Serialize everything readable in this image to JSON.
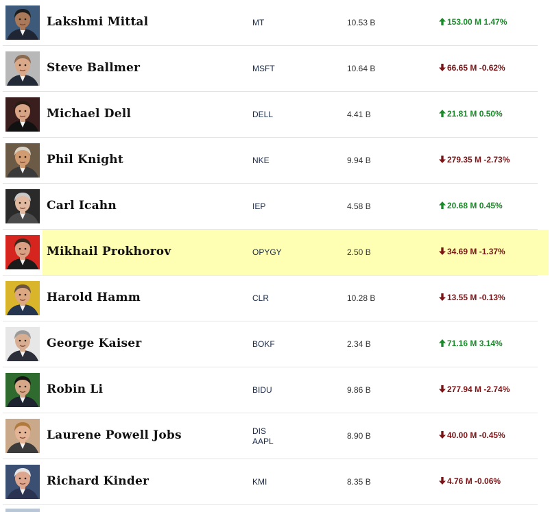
{
  "rows": [
    {
      "name": "Lakshmi Mittal",
      "ticker": [
        "MT"
      ],
      "worth": "10.53 B",
      "change": "153.00 M 1.47%",
      "direction": "up",
      "skin": "#a9795a",
      "hair": "#1c1c1c",
      "bg": "#3d5a7a",
      "suit": "#1f2533"
    },
    {
      "name": "Steve Ballmer",
      "ticker": [
        "MSFT"
      ],
      "worth": "10.64 B",
      "change": "66.65 M -0.62%",
      "direction": "down",
      "skin": "#d9a98a",
      "hair": "#8a6a50",
      "bg": "#b8b8b8",
      "suit": "#222a38"
    },
    {
      "name": "Michael Dell",
      "ticker": [
        "DELL"
      ],
      "worth": "4.41 B",
      "change": "21.81 M 0.50%",
      "direction": "up",
      "skin": "#d7a486",
      "hair": "#2a1c14",
      "bg": "#3a1d1d",
      "suit": "#111111"
    },
    {
      "name": "Phil Knight",
      "ticker": [
        "NKE"
      ],
      "worth": "9.94 B",
      "change": "279.35 M -2.73%",
      "direction": "down",
      "skin": "#d19c72",
      "hair": "#d8d2c4",
      "bg": "#6b5a45",
      "suit": "#3a3a3a"
    },
    {
      "name": "Carl Icahn",
      "ticker": [
        "IEP"
      ],
      "worth": "4.58 B",
      "change": "20.68 M 0.45%",
      "direction": "up",
      "skin": "#e0b9a0",
      "hair": "#c8c8c8",
      "bg": "#2a2a2a",
      "suit": "#4a4a4a"
    },
    {
      "name": "Mikhail Prokhorov",
      "ticker": [
        "OPYGY"
      ],
      "worth": "2.50 B",
      "change": "34.69 M -1.37%",
      "direction": "down",
      "skin": "#d9a084",
      "hair": "#3a2a1e",
      "bg": "#d6251f",
      "suit": "#1b1b1b"
    },
    {
      "name": "Harold Hamm",
      "ticker": [
        "CLR"
      ],
      "worth": "10.28 B",
      "change": "13.55 M -0.13%",
      "direction": "down",
      "skin": "#dca882",
      "hair": "#6a5440",
      "bg": "#d8b52a",
      "suit": "#25344f"
    },
    {
      "name": "George Kaiser",
      "ticker": [
        "BOKF"
      ],
      "worth": "2.34 B",
      "change": "71.16 M 3.14%",
      "direction": "up",
      "skin": "#d8ae92",
      "hair": "#9a9a9a",
      "bg": "#e7e7e7",
      "suit": "#2c2f3a"
    },
    {
      "name": "Robin Li",
      "ticker": [
        "BIDU"
      ],
      "worth": "9.86 B",
      "change": "277.94 M -2.74%",
      "direction": "down",
      "skin": "#d6a887",
      "hair": "#151515",
      "bg": "#2f6b2f",
      "suit": "#1d2430"
    },
    {
      "name": "Laurene Powell Jobs",
      "ticker": [
        "DIS",
        "AAPL"
      ],
      "worth": "8.90 B",
      "change": "40.00 M -0.45%",
      "direction": "down",
      "skin": "#e3b596",
      "hair": "#b07a3e",
      "bg": "#caa98a",
      "suit": "#3b3b3b"
    },
    {
      "name": "Richard Kinder",
      "ticker": [
        "KMI"
      ],
      "worth": "8.35 B",
      "change": "4.76 M -0.06%",
      "direction": "down",
      "skin": "#dca78e",
      "hair": "#e6e6e6",
      "bg": "#3b4f73",
      "suit": "#2a3452"
    }
  ],
  "highlight_index": 5,
  "colors": {
    "up": "#1b8a2a",
    "down": "#7a1416",
    "highlight": "#ffffb3",
    "separator": "#e4e4e4"
  },
  "icons": {
    "up": "arrow-up-icon",
    "down": "arrow-down-icon"
  }
}
